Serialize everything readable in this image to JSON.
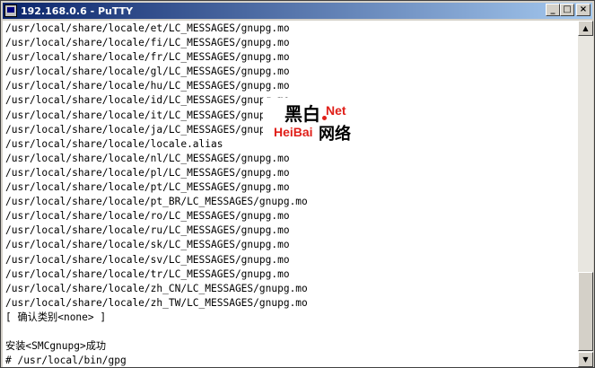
{
  "window": {
    "title": "192.168.0.6 - PuTTY"
  },
  "controls": {
    "minimize": "_",
    "maximize": "□",
    "close": "×"
  },
  "terminal": {
    "lines": [
      "/usr/local/share/locale/et/LC_MESSAGES/gnupg.mo",
      "/usr/local/share/locale/fi/LC_MESSAGES/gnupg.mo",
      "/usr/local/share/locale/fr/LC_MESSAGES/gnupg.mo",
      "/usr/local/share/locale/gl/LC_MESSAGES/gnupg.mo",
      "/usr/local/share/locale/hu/LC_MESSAGES/gnupg.mo",
      "/usr/local/share/locale/id/LC_MESSAGES/gnupg.mo",
      "/usr/local/share/locale/it/LC_MESSAGES/gnupg.mo",
      "/usr/local/share/locale/ja/LC_MESSAGES/gnupg.mo",
      "/usr/local/share/locale/locale.alias",
      "/usr/local/share/locale/nl/LC_MESSAGES/gnupg.mo",
      "/usr/local/share/locale/pl/LC_MESSAGES/gnupg.mo",
      "/usr/local/share/locale/pt/LC_MESSAGES/gnupg.mo",
      "/usr/local/share/locale/pt_BR/LC_MESSAGES/gnupg.mo",
      "/usr/local/share/locale/ro/LC_MESSAGES/gnupg.mo",
      "/usr/local/share/locale/ru/LC_MESSAGES/gnupg.mo",
      "/usr/local/share/locale/sk/LC_MESSAGES/gnupg.mo",
      "/usr/local/share/locale/sv/LC_MESSAGES/gnupg.mo",
      "/usr/local/share/locale/tr/LC_MESSAGES/gnupg.mo",
      "/usr/local/share/locale/zh_CN/LC_MESSAGES/gnupg.mo",
      "/usr/local/share/locale/zh_TW/LC_MESSAGES/gnupg.mo",
      "[ 确认类别<none> ]",
      "",
      "安装<SMCgnupg>成功",
      "# /usr/local/bin/gpg"
    ]
  },
  "watermark": {
    "cn_top": "黑白",
    "net": "Net",
    "en": "HeiBai",
    "cn_bottom": "网络"
  },
  "colors": {
    "title_start": "#0a246a",
    "title_end": "#a6caf0",
    "watermark_red": "#e0201a"
  }
}
